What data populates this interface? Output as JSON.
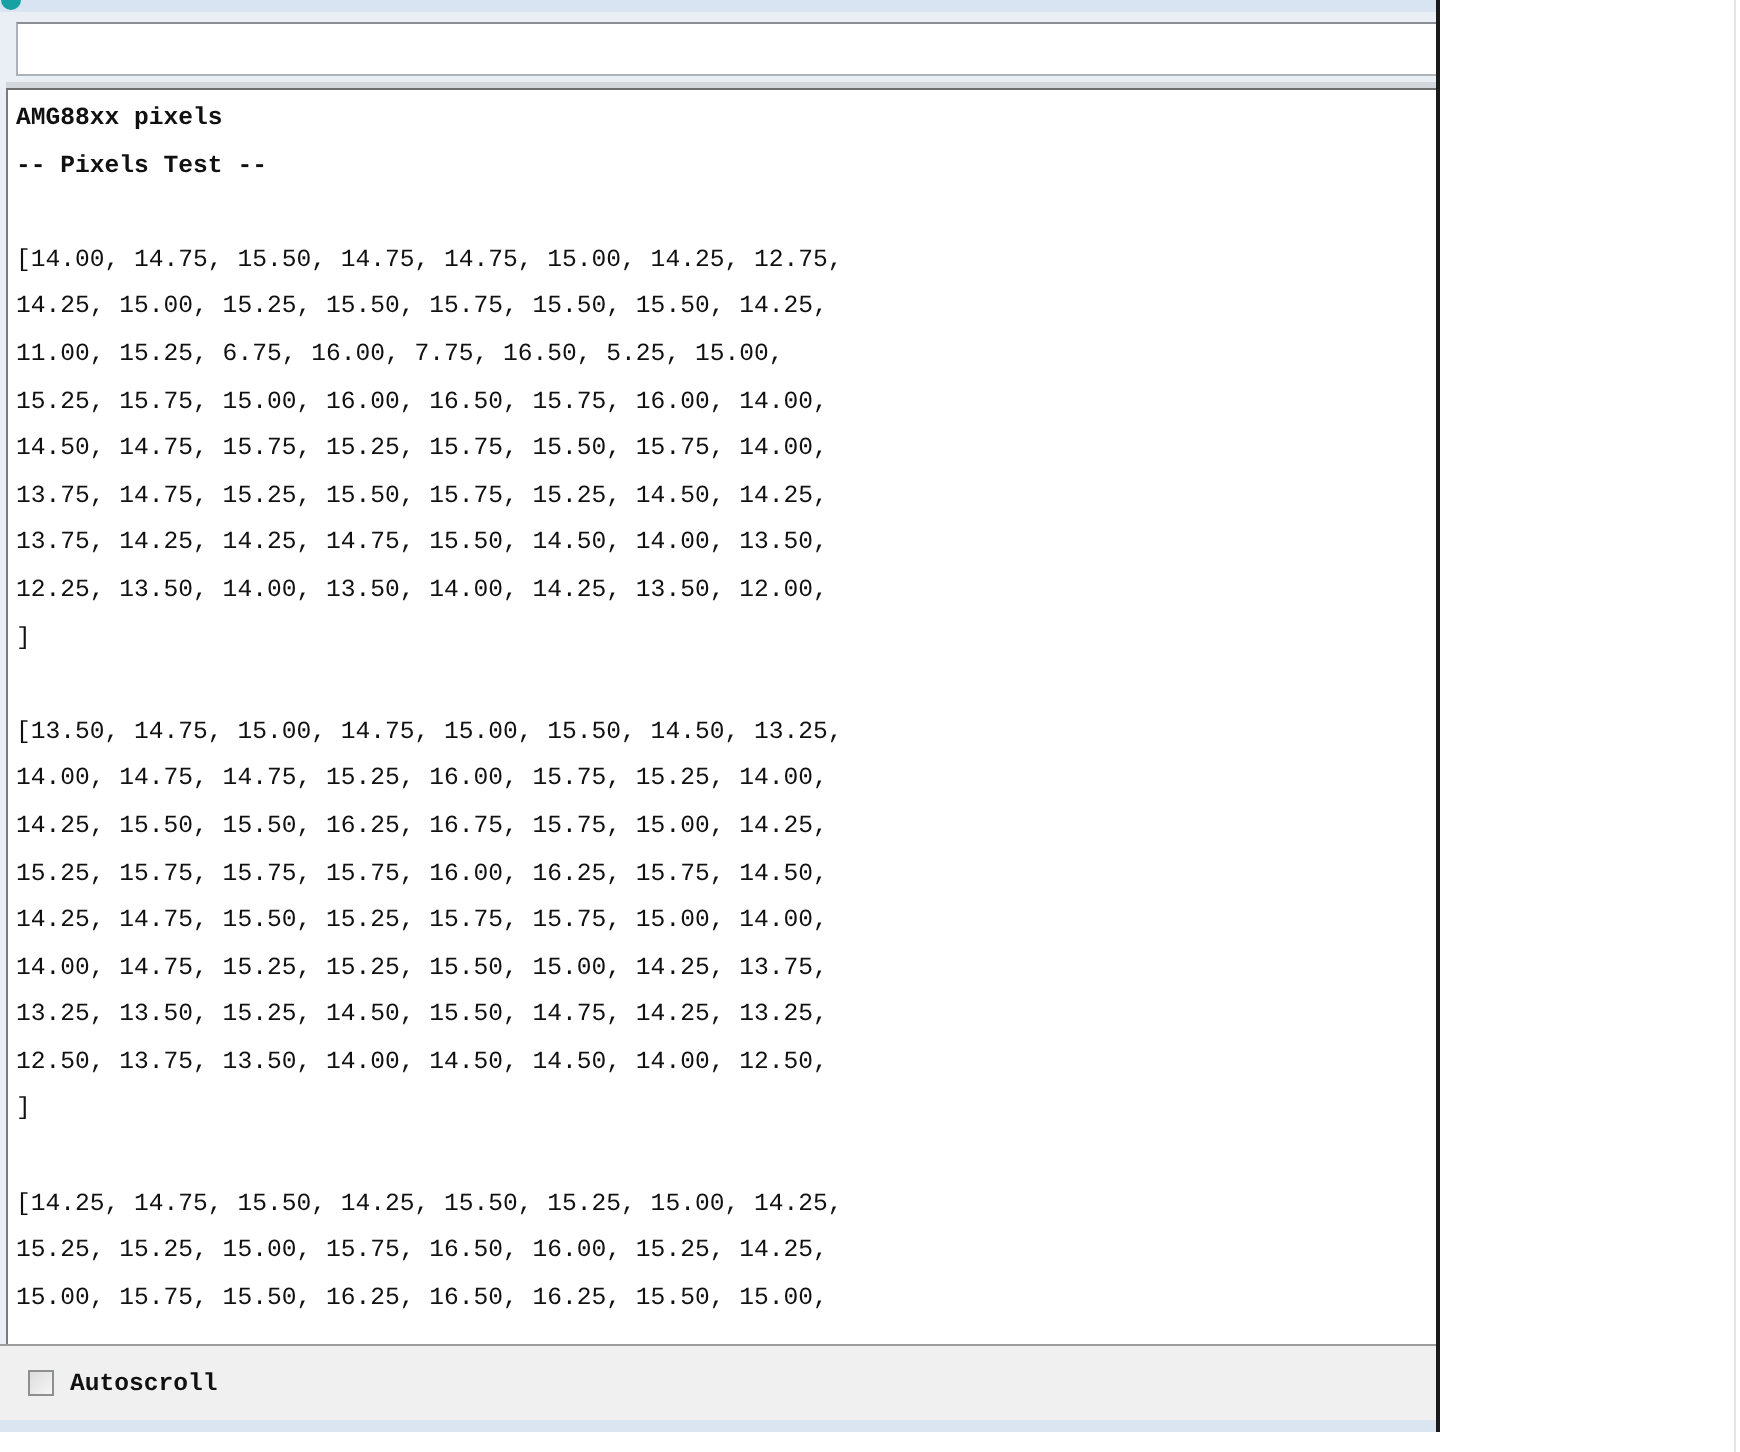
{
  "output": {
    "header": [
      "AMG88xx pixels",
      "-- Pixels Test --"
    ],
    "frames": [
      {
        "rows": [
          "[14.00, 14.75, 15.50, 14.75, 14.75, 15.00, 14.25, 12.75,",
          "14.25, 15.00, 15.25, 15.50, 15.75, 15.50, 15.50, 14.25,",
          "11.00, 15.25, 6.75, 16.00, 7.75, 16.50, 5.25, 15.00,",
          "15.25, 15.75, 15.00, 16.00, 16.50, 15.75, 16.00, 14.00,",
          "14.50, 14.75, 15.75, 15.25, 15.75, 15.50, 15.75, 14.00,",
          "13.75, 14.75, 15.25, 15.50, 15.75, 15.25, 14.50, 14.25,",
          "13.75, 14.25, 14.25, 14.75, 15.50, 14.50, 14.00, 13.50,",
          "12.25, 13.50, 14.00, 13.50, 14.00, 14.25, 13.50, 12.00,"
        ],
        "close": "]"
      },
      {
        "rows": [
          "[13.50, 14.75, 15.00, 14.75, 15.00, 15.50, 14.50, 13.25,",
          "14.00, 14.75, 14.75, 15.25, 16.00, 15.75, 15.25, 14.00,",
          "14.25, 15.50, 15.50, 16.25, 16.75, 15.75, 15.00, 14.25,",
          "15.25, 15.75, 15.75, 15.75, 16.00, 16.25, 15.75, 14.50,",
          "14.25, 14.75, 15.50, 15.25, 15.75, 15.75, 15.00, 14.00,",
          "14.00, 14.75, 15.25, 15.25, 15.50, 15.00, 14.25, 13.75,",
          "13.25, 13.50, 15.25, 14.50, 15.50, 14.75, 14.25, 13.25,",
          "12.50, 13.75, 13.50, 14.00, 14.50, 14.50, 14.00, 12.50,"
        ],
        "close": "]"
      },
      {
        "rows": [
          "[14.25, 14.75, 15.50, 14.25, 15.50, 15.25, 15.00, 14.25,",
          "15.25, 15.25, 15.00, 15.75, 16.50, 16.00, 15.25, 14.25,",
          "15.00, 15.75, 15.50, 16.25, 16.50, 16.25, 15.50, 15.00,"
        ]
      }
    ]
  },
  "autoscroll": {
    "label": "Autoscroll",
    "checked": false
  }
}
